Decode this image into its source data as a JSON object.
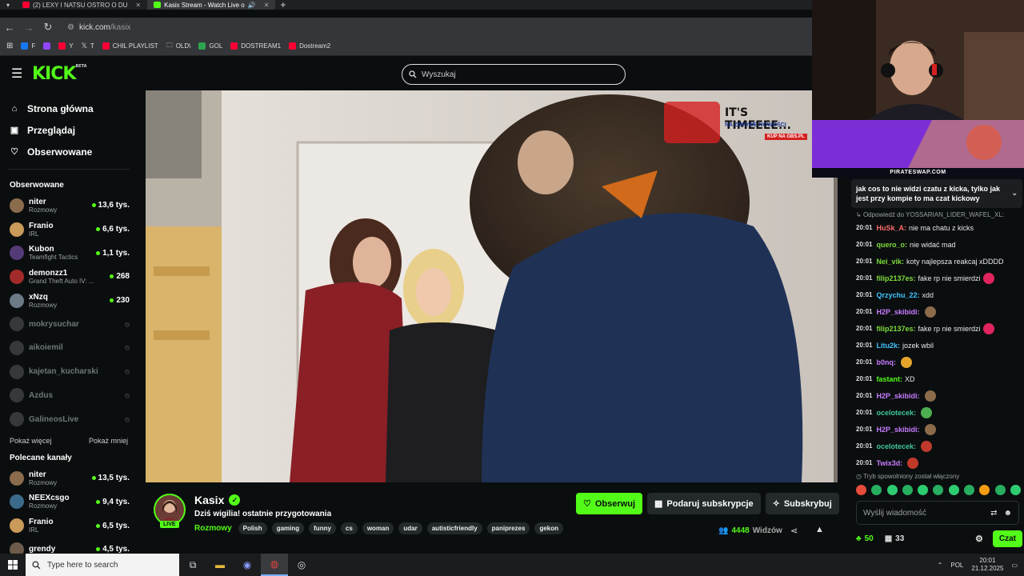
{
  "browser": {
    "tabs": [
      {
        "title": "(2) LEXY I NATSU OSTRO O DU",
        "active": false,
        "favicon_color": "#ff0033"
      },
      {
        "title": "Kasix Stream - Watch Live o",
        "active": true,
        "favicon_color": "#53fc18"
      }
    ],
    "url_domain": "kick.com",
    "url_path": "/kasix",
    "bookmarks": [
      {
        "label": "F",
        "color": "#1877f2"
      },
      {
        "label": "",
        "color": "#9146ff"
      },
      {
        "label": "Y",
        "color": "#ff0033"
      },
      {
        "label": "T",
        "color": "#dddddd"
      },
      {
        "label": "CHIL PLAYLIST",
        "color": "#ff0033"
      },
      {
        "label": "OLD\\",
        "color": "#cccccc"
      },
      {
        "label": "GOL",
        "color": "#2ea44f"
      },
      {
        "label": "DOSTREAM1",
        "color": "#ff0033"
      },
      {
        "label": "Dostream2",
        "color": "#ff0033"
      }
    ]
  },
  "header": {
    "logo": "KICK",
    "logo_beta": "BETA",
    "search_placeholder": "Wyszukaj"
  },
  "sidebar": {
    "nav": [
      {
        "label": "Strona główna",
        "icon": "home-icon"
      },
      {
        "label": "Przeglądaj",
        "icon": "browse-icon"
      },
      {
        "label": "Obserwowane",
        "icon": "heart-icon"
      }
    ],
    "followed_heading": "Obserwowane",
    "followed": [
      {
        "name": "niter",
        "category": "Rozmowy",
        "viewers": "13,6 tys.",
        "live": true,
        "color": "#8a6b4c"
      },
      {
        "name": "Franio",
        "category": "IRL",
        "viewers": "6,6 tys.",
        "live": true,
        "color": "#c99a58"
      },
      {
        "name": "Kubon",
        "category": "Teamfight Tactics",
        "viewers": "1,1 tys.",
        "live": true,
        "color": "#553a78"
      },
      {
        "name": "demonzz1",
        "category": "Grand Theft Auto IV: ...",
        "viewers": "268",
        "live": true,
        "color": "#a32a2a"
      },
      {
        "name": "xNzq",
        "category": "Rozmowy",
        "viewers": "230",
        "live": true,
        "color": "#6c7a86"
      },
      {
        "name": "mokrysuchar",
        "category": "",
        "viewers": "",
        "live": false,
        "color": "#555555"
      },
      {
        "name": "aikoiemil",
        "category": "",
        "viewers": "",
        "live": false,
        "color": "#555555"
      },
      {
        "name": "kajetan_kucharski",
        "category": "",
        "viewers": "",
        "live": false,
        "color": "#555555"
      },
      {
        "name": "Azdus",
        "category": "",
        "viewers": "",
        "live": false,
        "color": "#555555"
      },
      {
        "name": "GalineosLive",
        "category": "",
        "viewers": "",
        "live": false,
        "color": "#555555"
      }
    ],
    "show_more": "Pokaż więcej",
    "show_less": "Pokaż mniej",
    "recommended_heading": "Polecane kanały",
    "recommended": [
      {
        "name": "niter",
        "category": "Rozmowy",
        "viewers": "13,5 tys.",
        "color": "#8a6b4c"
      },
      {
        "name": "NEEXcsgo",
        "category": "Rozmowy",
        "viewers": "9,4 tys.",
        "color": "#3b6a8a"
      },
      {
        "name": "Franio",
        "category": "IRL",
        "viewers": "6,5 tys.",
        "color": "#c99a58"
      },
      {
        "name": "grendy",
        "category": "",
        "viewers": "4,5 tys.",
        "color": "#6d5a4a"
      }
    ]
  },
  "overlay": {
    "ad_headline": "IT'S TIMEEEE...",
    "ad_sub": "NA ZIMOWE NOWOŚCI",
    "ad_cta": "KUP NA GBS.PL",
    "sponsor": "PIRATESWAP.COM"
  },
  "stream": {
    "streamer": "Kasix",
    "live_label": "LIVE",
    "title": "Dziś wigilia! ostatnie przygotowania",
    "category": "Rozmowy",
    "tags": [
      "Polish",
      "gaming",
      "funny",
      "cs",
      "woman",
      "udar",
      "autisticfriendly",
      "paniprezes",
      "gekon"
    ],
    "follow_label": "Obserwuj",
    "gift_label": "Podaruj subskrypcje",
    "subscribe_label": "Subskrybuj",
    "viewers": "4448",
    "viewers_label": "Widzów"
  },
  "chat": {
    "pinned": "jak cos to nie widzi czatu z kicka, tylko jak jest przy kompie to ma czat kickowy",
    "reply_to": "Odpowiedź do YOSSARIAN_LIDER_WAFEL_XL:",
    "messages": [
      {
        "time": "20:01",
        "user": "HuSk_A:",
        "color": "#ff6b6b",
        "text": "nie ma chatu z kicks",
        "emote": ""
      },
      {
        "time": "20:01",
        "user": "quero_o:",
        "color": "#7fdc3c",
        "text": "nie widać mad",
        "emote": ""
      },
      {
        "time": "20:01",
        "user": "Nei_vik:",
        "color": "#7fdc3c",
        "text": "koty najlepsza reakcaj xDDDD",
        "emote": ""
      },
      {
        "time": "20:01",
        "user": "filip2137es:",
        "color": "#7fdc3c",
        "text": "fake rp nie smierdzi",
        "emote": "#e0245e"
      },
      {
        "time": "20:01",
        "user": "Qrzychu_22:",
        "color": "#3ec6ff",
        "text": "xdd",
        "emote": ""
      },
      {
        "time": "20:01",
        "user": "H2P_skibidi:",
        "color": "#c77dff",
        "text": "",
        "emote": "#8b6b4a"
      },
      {
        "time": "20:01",
        "user": "filip2137es:",
        "color": "#7fdc3c",
        "text": "fake rp nie smierdzi",
        "emote": "#e0245e"
      },
      {
        "time": "20:01",
        "user": "Litu2k:",
        "color": "#3ec6ff",
        "text": "jozek wbil",
        "emote": ""
      },
      {
        "time": "20:01",
        "user": "b0nq:",
        "color": "#c77dff",
        "text": "",
        "emote": "#e5a52b"
      },
      {
        "time": "20:01",
        "user": "fastant:",
        "color": "#53fc18",
        "text": "XD",
        "emote": ""
      },
      {
        "time": "20:01",
        "user": "H2P_skibidi:",
        "color": "#c77dff",
        "text": "",
        "emote": "#8b6b4a"
      },
      {
        "time": "20:01",
        "user": "ocelotecek:",
        "color": "#3ec6a0",
        "text": "",
        "emote": "#4caf50"
      },
      {
        "time": "20:01",
        "user": "H2P_skibidi:",
        "color": "#c77dff",
        "text": "",
        "emote": "#8b6b4a"
      },
      {
        "time": "20:01",
        "user": "ocelotecek:",
        "color": "#3ec6a0",
        "text": "",
        "emote": "#c0392b"
      },
      {
        "time": "20:01",
        "user": "Twix3d:",
        "color": "#c77dff",
        "text": "",
        "emote": "#c0392b"
      }
    ],
    "slow_mode": "Tryb spowolniony został włączony",
    "emote_colors": [
      "#e74c3c",
      "#27ae60",
      "#2ecc71",
      "#27ae60",
      "#2ecc71",
      "#27ae60",
      "#2ecc71",
      "#27ae60",
      "#f39c12",
      "#27ae60",
      "#2ecc71"
    ],
    "input_placeholder": "Wyślij wiadomość",
    "points": "50",
    "gifts": "33",
    "send_label": "Czat"
  },
  "taskbar": {
    "search_placeholder": "Type here to search",
    "lang": "POL",
    "time": "20:01",
    "date": "21.12.2025"
  },
  "colors": {
    "accent": "#53fc18",
    "bg": "#0b0e0f"
  }
}
